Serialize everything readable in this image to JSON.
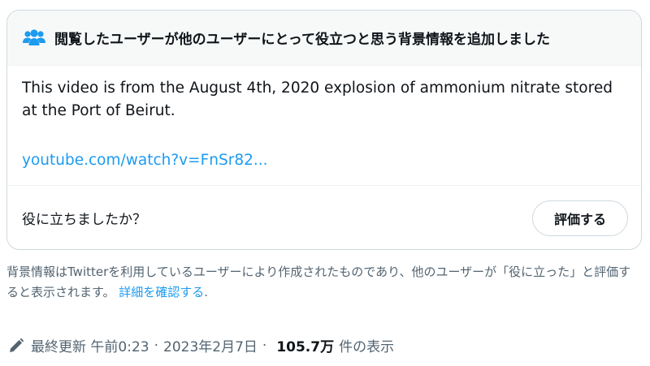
{
  "note": {
    "header_title": "閲覧したユーザーが他のユーザーにとって役立つと思う背景情報を追加しました",
    "header_icon": "people-icon",
    "body_text": "This video is from the August 4th, 2020 explosion of ammonium nitrate stored at the Port of Beirut.",
    "link_text": "youtube.com/watch?v=FnSr82...",
    "helpful_question": "役に立ちましたか？",
    "rate_button_label": "評価する"
  },
  "disclaimer": {
    "text": "背景情報はTwitterを利用しているユーザーにより作成されたものであり、他のユーザーが「役に立った」と評価すると表示されます。 ",
    "learn_more": "詳細を確認する",
    "period": "."
  },
  "meta": {
    "edit_icon": "pencil-icon",
    "last_edited": "最終更新 午前0:23",
    "separator": "·",
    "date": "2023年2月7日",
    "views_count": "105.7万",
    "views_label": "件の表示"
  },
  "colors": {
    "link": "#1d9bf0",
    "secondary_text": "#536471",
    "border": "#cfd9de",
    "header_bg": "#f7f9f9",
    "icon_blue": "#1d9bf0"
  }
}
